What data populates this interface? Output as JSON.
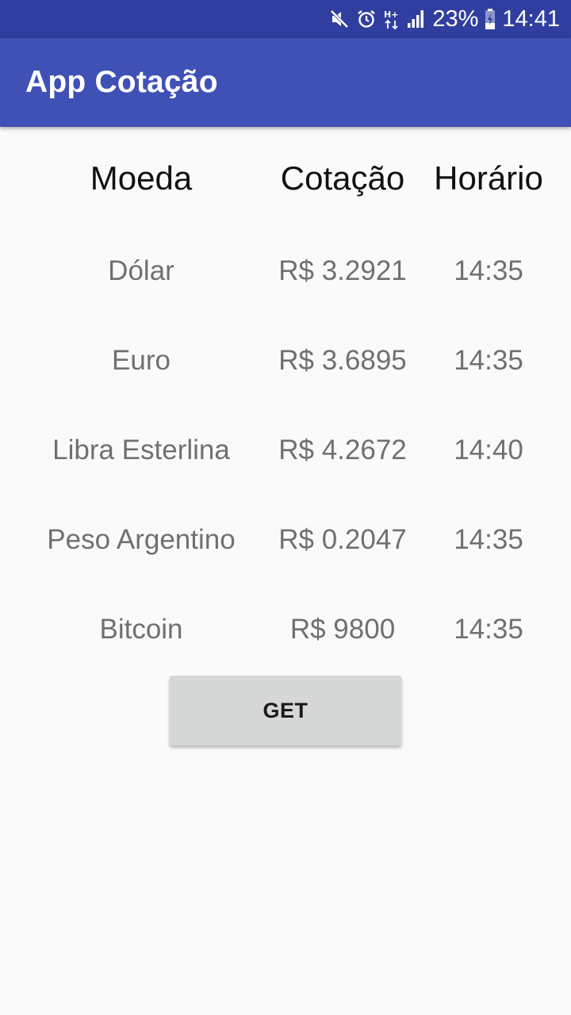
{
  "status_bar": {
    "icons": [
      "mute-icon",
      "alarm-icon",
      "hplus-data-icon",
      "signal-icon",
      "battery-charging-icon"
    ],
    "network_label": "H+",
    "battery": "23%",
    "time": "14:41"
  },
  "app_bar": {
    "title": "App Cotação"
  },
  "table": {
    "headers": [
      "Moeda",
      "Cotação",
      "Horário"
    ],
    "rows": [
      {
        "moeda": "Dólar",
        "cotacao": "R$ 3.2921",
        "horario": "14:35"
      },
      {
        "moeda": "Euro",
        "cotacao": "R$ 3.6895",
        "horario": "14:35"
      },
      {
        "moeda": "Libra Esterlina",
        "cotacao": "R$ 4.2672",
        "horario": "14:40"
      },
      {
        "moeda": "Peso Argentino",
        "cotacao": "R$ 0.2047",
        "horario": "14:35"
      },
      {
        "moeda": "Bitcoin",
        "cotacao": "R$ 9800",
        "horario": "14:35"
      }
    ]
  },
  "get_button": {
    "label": "GET"
  },
  "colors": {
    "status_bar": "#303f9f",
    "app_bar": "#3f51b5",
    "background": "#fafafa",
    "button": "#d6d7d7"
  }
}
